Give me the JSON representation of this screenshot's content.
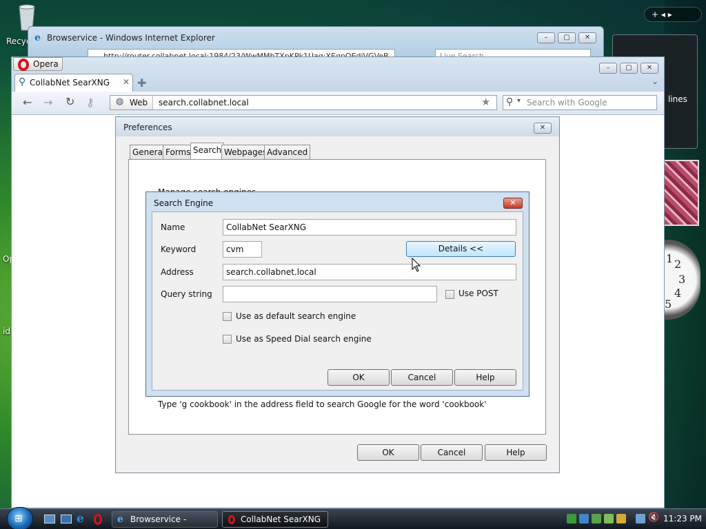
{
  "desktop": {
    "icon_recycle_label": "Recyc",
    "edge_text_1": "Op",
    "edge_text_2": "id",
    "sidebar_gadget_text": "lines",
    "gadget_controls": "+ ◂ ▸",
    "clock_numbers": [
      "1",
      "2",
      "3",
      "4",
      "5"
    ]
  },
  "ie_window": {
    "title": "Browservice - Windows Internet Explorer",
    "address": "http://router.collabnet.local:1984/23/WwMMhTXpKPk1Uaq:XEgpQEdiVGVeB",
    "search_placeholder": "Live Search"
  },
  "opera": {
    "menu_label": "Opera",
    "tab_title": "CollabNet SearXNG",
    "address_prefix": "Web",
    "address": "search.collabnet.local",
    "search_placeholder": "Search with Google"
  },
  "preferences": {
    "title": "Preferences",
    "tabs": [
      "General",
      "Forms",
      "Search",
      "Webpages",
      "Advanced"
    ],
    "active_tab": "Search",
    "partial_heading": "Manage search engines",
    "hint": "Type 'g cookbook' in the address field to search Google for the word 'cookbook'",
    "ok": "OK",
    "cancel": "Cancel",
    "help": "Help"
  },
  "search_engine": {
    "title": "Search Engine",
    "name_label": "Name",
    "name_value": "CollabNet SearXNG",
    "keyword_label": "Keyword",
    "keyword_value": "cvm",
    "details_button": "Details <<",
    "address_label": "Address",
    "address_value": "search.collabnet.local",
    "query_label": "Query string",
    "query_value": "",
    "use_post": "Use POST",
    "default_engine": "Use as default search engine",
    "speed_dial": "Use as Speed Dial search engine",
    "ok": "OK",
    "cancel": "Cancel",
    "help": "Help"
  },
  "taskbar": {
    "ie_task": "Browservice - Wind...",
    "opera_task": "CollabNet SearXNG ...",
    "time": "11:23 PM"
  },
  "colors": {
    "opera_red": "#d6141c",
    "close_red": "#c43a26",
    "focus_blue": "#3c7fb1"
  }
}
